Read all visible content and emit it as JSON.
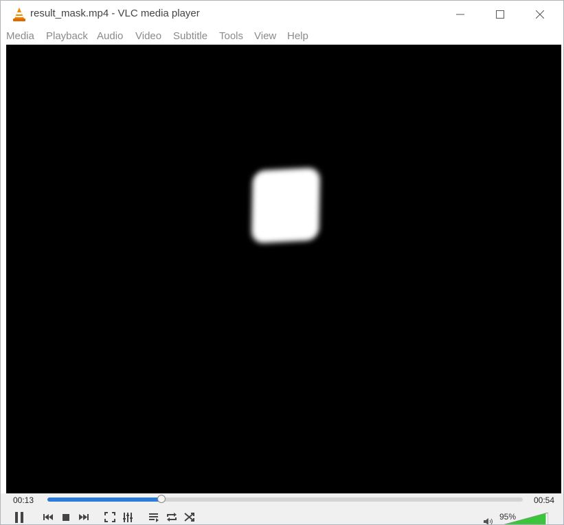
{
  "window": {
    "title": "result_mask.mp4 - VLC media player",
    "app_icon": "vlc-cone-icon",
    "controls": [
      "minimize-icon",
      "maximize-icon",
      "close-icon"
    ]
  },
  "menu": {
    "items": [
      "Media",
      "Playback",
      "Audio",
      "Video",
      "Subtitle",
      "Tools",
      "View",
      "Help"
    ]
  },
  "player": {
    "elapsed": "00:13",
    "total": "00:54",
    "progress": 0.24,
    "volume_label": "95%",
    "volume_level": 0.95,
    "accent_color": "#2f7bd8",
    "volume_color": "#3cc43c"
  },
  "buttons": [
    "pause-icon",
    "previous-icon",
    "stop-icon",
    "next-icon",
    "fullscreen-icon",
    "extended-settings-icon",
    "playlist-icon",
    "loop-icon",
    "shuffle-icon",
    "speaker-icon"
  ]
}
